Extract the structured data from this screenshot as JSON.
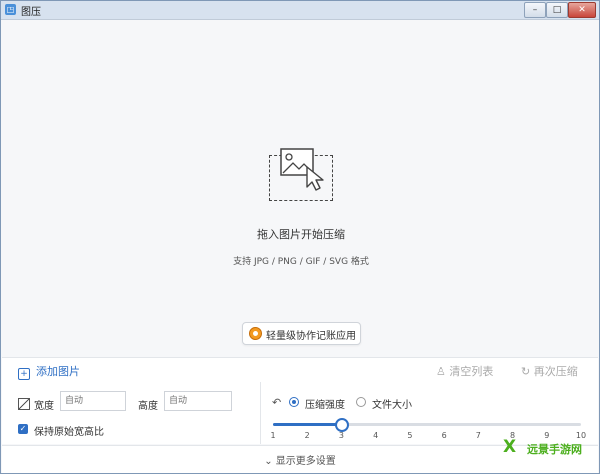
{
  "window": {
    "title": "图压",
    "min_glyph": "–",
    "max_glyph": "□",
    "close_glyph": "✕"
  },
  "dropzone": {
    "title": "拖入图片开始压缩",
    "formats": "支持 JPG / PNG / GIF / SVG 格式",
    "promo_label": "轻量级协作记账应用"
  },
  "toolbar": {
    "add_label": "添加图片",
    "add_glyph": "+",
    "clear_label": "清空列表",
    "clear_glyph": "♙",
    "redo_label": "再次压缩",
    "redo_glyph": "↻"
  },
  "size_settings": {
    "width_label": "宽度",
    "width_placeholder": "自动",
    "height_label": "高度",
    "height_placeholder": "自动",
    "keep_ratio_label": "保持原始宽高比",
    "keep_ratio_checked": true,
    "check_glyph": "✓"
  },
  "compress_settings": {
    "mode_icon": "speed-gauge-icon",
    "mode_glyph": "↶",
    "strength_label": "压缩强度",
    "filesize_label": "文件大小",
    "selected_mode": "strength",
    "slider_value": 3,
    "slider_min": 1,
    "slider_max": 10,
    "ticks": [
      "1",
      "2",
      "3",
      "4",
      "5",
      "6",
      "7",
      "8",
      "9",
      "10"
    ]
  },
  "footer": {
    "more_label": "显示更多设置",
    "more_glyph": "⌄"
  },
  "watermark": {
    "glyph": "X",
    "text": "远景手游网"
  },
  "colors": {
    "accent": "#2f6fc4",
    "titlebar": "#d7e2ef",
    "watermark": "#4caf1e"
  }
}
